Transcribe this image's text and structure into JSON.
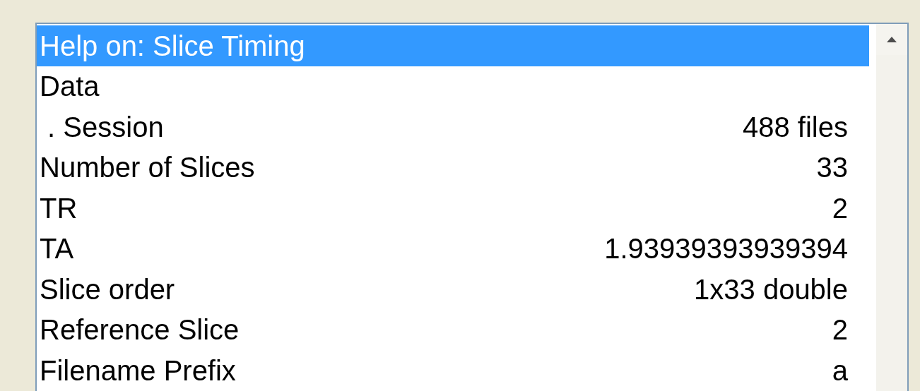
{
  "list": {
    "items": [
      {
        "label": "Help on: Slice Timing",
        "selected": true
      },
      {
        "label": "Data",
        "selected": false
      },
      {
        "label": " . Session",
        "value": "488 files",
        "selected": false
      },
      {
        "label": "Number of Slices",
        "value": "33",
        "selected": false
      },
      {
        "label": "TR",
        "value": "2",
        "selected": false
      },
      {
        "label": "TA",
        "value": "1.93939393939394",
        "selected": false
      },
      {
        "label": "Slice order",
        "value": "1x33 double",
        "selected": false
      },
      {
        "label": "Reference Slice",
        "value": "2",
        "selected": false
      },
      {
        "label": "Filename Prefix",
        "value": "a",
        "selected": false
      }
    ]
  }
}
